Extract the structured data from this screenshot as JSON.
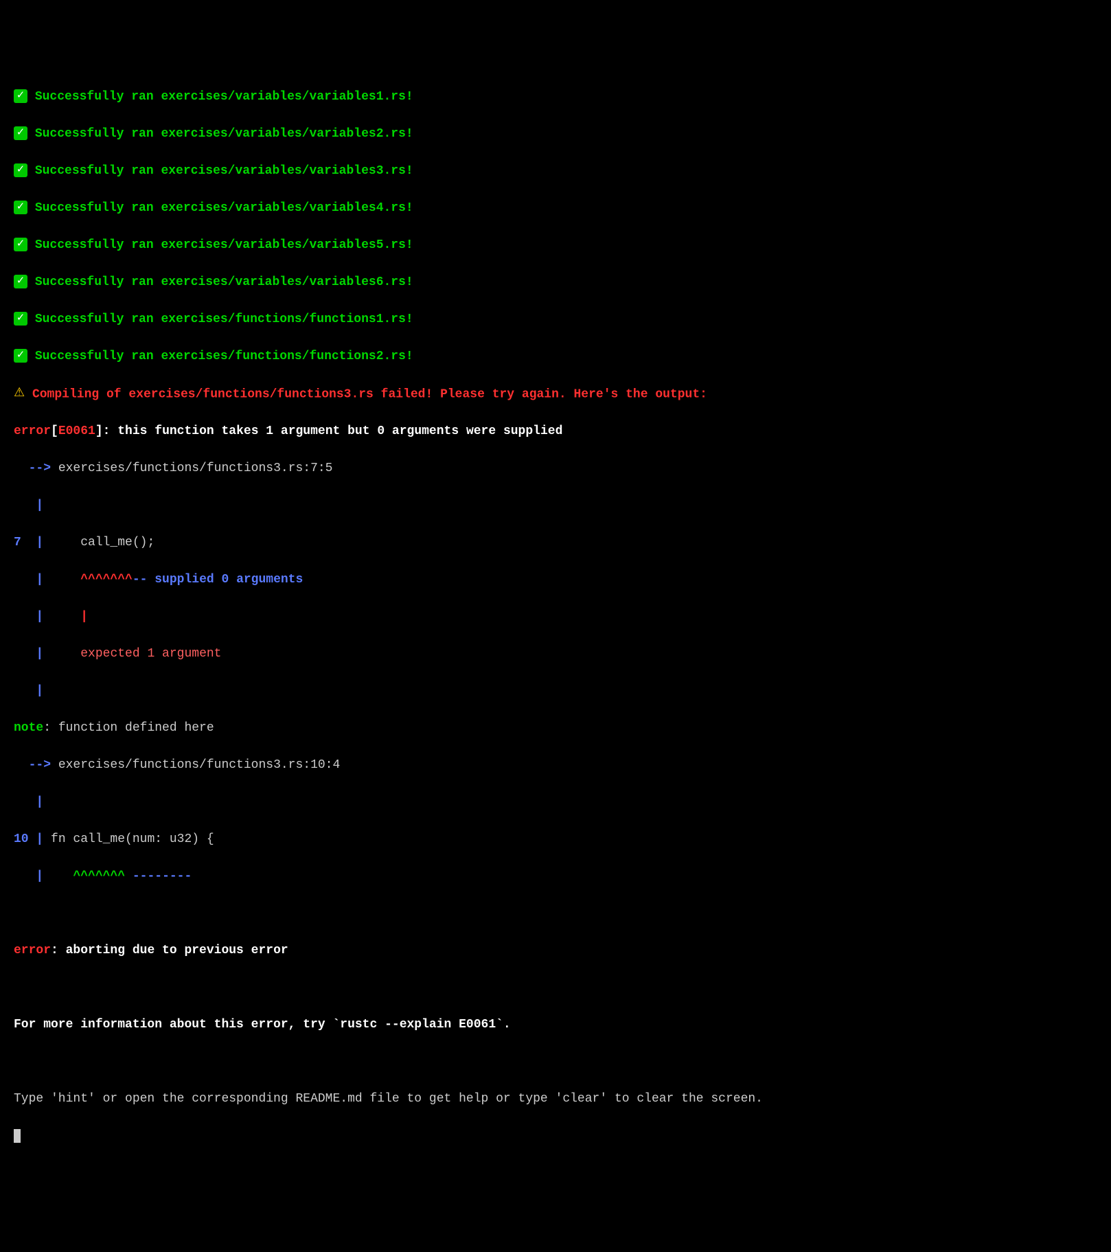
{
  "successes": [
    "Successfully ran exercises/variables/variables1.rs!",
    "Successfully ran exercises/variables/variables2.rs!",
    "Successfully ran exercises/variables/variables3.rs!",
    "Successfully ran exercises/variables/variables4.rs!",
    "Successfully ran exercises/variables/variables5.rs!",
    "Successfully ran exercises/variables/variables6.rs!",
    "Successfully ran exercises/functions/functions1.rs!",
    "Successfully ran exercises/functions/functions2.rs!"
  ],
  "fail": {
    "compiling_prefix": "Compiling of ",
    "failed_path": "exercises/functions/functions3.rs",
    "failed_suffix": " failed! Please try again. Here's the output:"
  },
  "error": {
    "label": "error",
    "code_open": "[",
    "code": "E0061",
    "code_close": "]",
    "msg": ": this function takes 1 argument but 0 arguments were supplied",
    "arrow": "  --> ",
    "location": "exercises/functions/functions3.rs:7:5",
    "gutter_empty": "   |",
    "line_num": "7  ",
    "gutter_pipe": "|",
    "code_line": "     call_me();",
    "caret_prefix": "   ",
    "caret_pipe": "|",
    "carets": "     ^^^^^^^",
    "caret_dashes": "--",
    "supplied_msg": " supplied 0 arguments",
    "mid_caret_line": "   |     |",
    "expected_prefix": "   ",
    "expected_pipe": "|",
    "expected_pad": "     ",
    "expected_msg": "expected 1 argument"
  },
  "note": {
    "label": "note",
    "msg": ": function defined here",
    "arrow": "  --> ",
    "location": "exercises/functions/functions3.rs:10:4",
    "gutter_empty": "   |",
    "line_num": "10 ",
    "gutter_pipe": "|",
    "code_line": " fn call_me(num: u32) {",
    "caret_prefix": "   ",
    "caret_pipe": "|",
    "caret_pad": "    ",
    "carets": "^^^^^^^",
    "dashes": " --------"
  },
  "abort": {
    "label": "error",
    "msg": ": aborting due to previous error"
  },
  "footer": {
    "more_info": "For more information about this error, try `rustc --explain E0061`.",
    "hint": "Type 'hint' or open the corresponding README.md file to get help or type 'clear' to clear the screen."
  }
}
